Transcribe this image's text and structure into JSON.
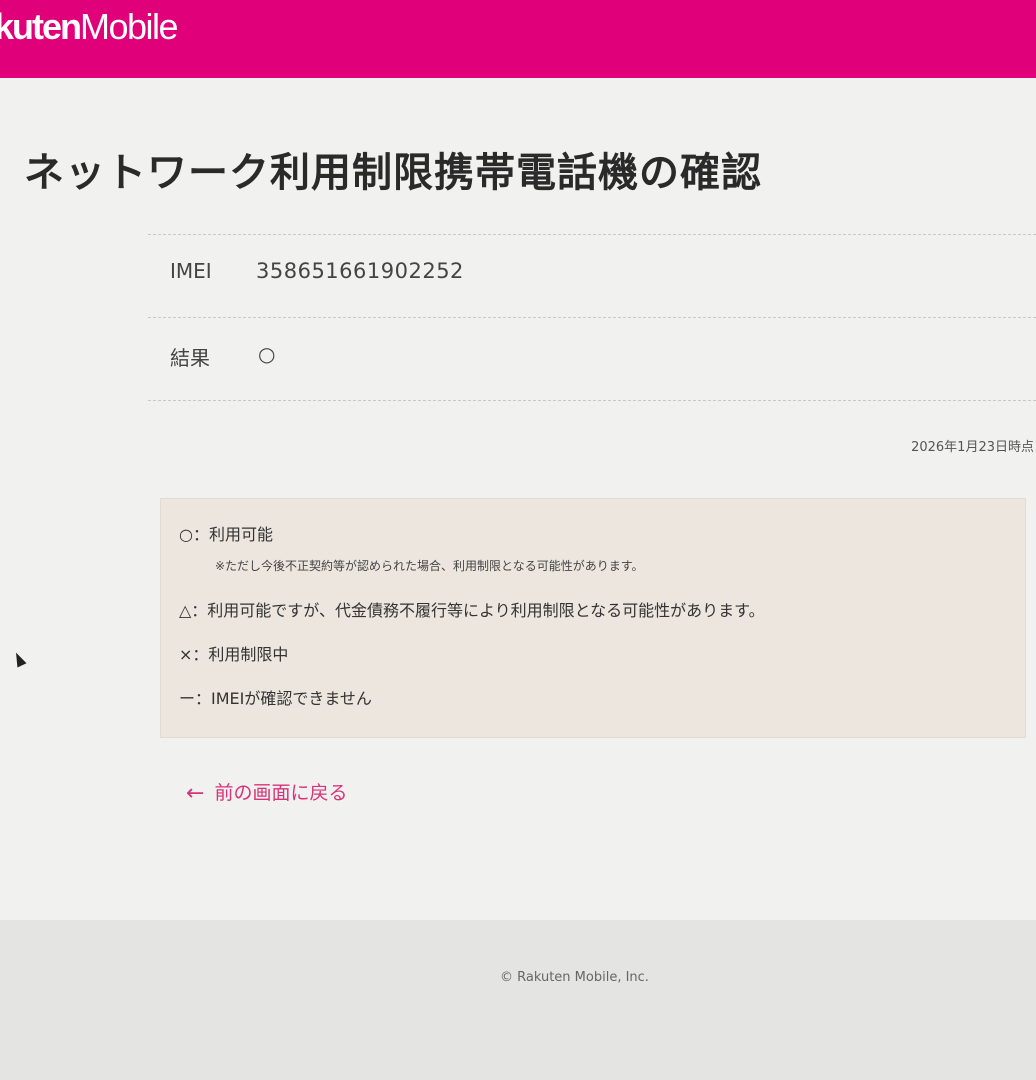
{
  "header": {
    "logo_brand": "kuten",
    "logo_product": "Mobile",
    "brand_color": "#e0007a"
  },
  "page": {
    "title": "ネットワーク利用制限携帯電話機の確認",
    "rows": [
      {
        "label": "IMEI",
        "value": "358651661902252"
      },
      {
        "label": "結果",
        "value": "○"
      }
    ],
    "as_of": "2026年1月23日時点"
  },
  "legend": {
    "ok": "○：利用可能",
    "ok_note": "※ただし今後不正契約等が認められた場合、利用制限となる可能性があります。",
    "caution": "△：利用可能ですが、代金債務不履行等により利用制限となる可能性があります。",
    "restricted": "×：利用制限中",
    "unknown": "ー：IMEIが確認できません"
  },
  "nav": {
    "back_arrow": "←",
    "back_label": "前の画面に戻る",
    "link_color": "#d6337a"
  },
  "footer": {
    "copyright": "© Rakuten Mobile, Inc."
  }
}
